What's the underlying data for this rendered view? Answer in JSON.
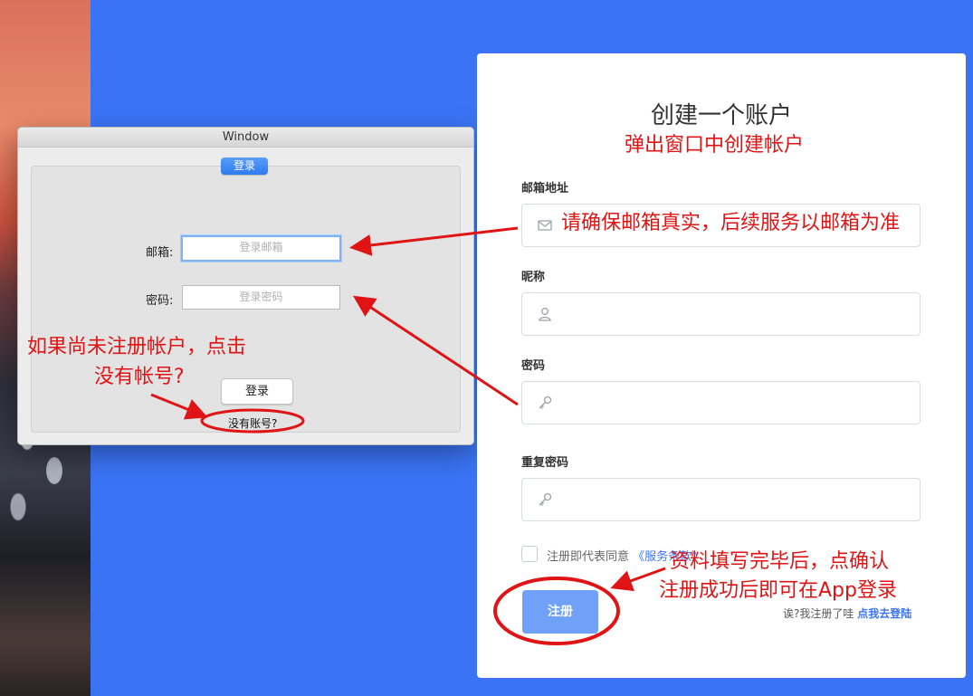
{
  "window": {
    "title": "Window",
    "tab_label": "登录",
    "email_label": "邮箱:",
    "email_placeholder": "登录邮箱",
    "password_label": "密码:",
    "password_placeholder": "登录密码",
    "login_button": "登录",
    "no_account_link": "没有账号?"
  },
  "register": {
    "title": "创建一个账户",
    "email_label": "邮箱地址",
    "nickname_label": "昵称",
    "password_label": "密码",
    "confirm_label": "重复密码",
    "terms_prefix": "注册即代表同意",
    "terms_link": "《服务条款》",
    "submit": "注册",
    "login_hint_prefix": "诶?我注册了哇",
    "login_hint_link": "点我去登陆"
  },
  "annotations": {
    "popup_note": "弹出窗口中创建帐户",
    "email_note": "请确保邮箱真实，后续服务以邮箱为准",
    "no_account_note_line1": "如果尚未注册帐户，点击",
    "no_account_note_line2": "没有帐号?",
    "submit_note_line1": "资料填写完毕后，点确认",
    "submit_note_line2": "注册成功后即可在App登录"
  },
  "icons": {
    "email": "mail-icon",
    "nickname": "user-icon",
    "password": "key-icon",
    "confirm": "key-icon"
  },
  "colors": {
    "background": "#3a74f5",
    "accent": "#3a74f5",
    "submit": "#6ea1f7",
    "annotation": "#e01414"
  }
}
